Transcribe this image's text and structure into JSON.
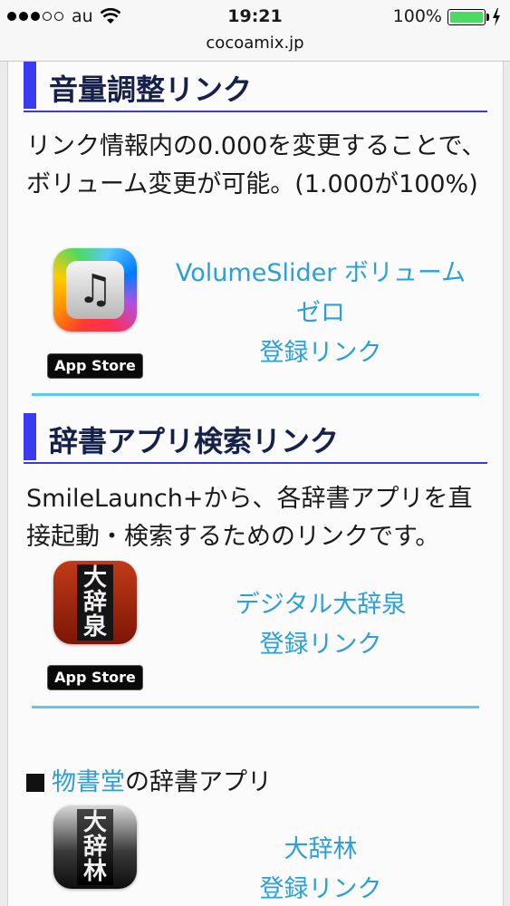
{
  "status_bar": {
    "carrier": "au",
    "time": "19:21",
    "battery_percent": "100%",
    "signal_bars_filled": 3,
    "signal_bars_total": 5
  },
  "browser": {
    "url": "cocoamix.jp"
  },
  "sections": [
    {
      "heading": "音量調整リンク",
      "description": "リンク情報内の0.000を変更することで、ボリューム変更が可能。(1.000が100%)",
      "app": {
        "icon": "music-note-icon",
        "store_badge": "App Store",
        "name": "VolumeSlider ボリュームゼロ",
        "link_label": "登録リンク"
      }
    },
    {
      "heading": "辞書アプリ検索リンク",
      "description": "SmileLaunch+から、各辞書アプリを直接起動・検索するためのリンクです。",
      "app": {
        "icon": "daijisen-icon",
        "icon_chars": [
          "大",
          "辞",
          "泉"
        ],
        "store_badge": "App Store",
        "name": "デジタル大辞泉",
        "link_label": "登録リンク"
      }
    }
  ],
  "publisher_line": {
    "marker": "■",
    "publisher_link": "物書堂",
    "suffix": "の辞書アプリ"
  },
  "publisher_app": {
    "icon": "daijirin-icon",
    "icon_chars": [
      "大",
      "辞",
      "林"
    ],
    "name": "大辞林",
    "link_label": "登録リンク"
  },
  "colors": {
    "link": "#2b9fd6",
    "heading_accent": "#3a3af0",
    "divider": "#5fc6ee",
    "battery": "#4cd964"
  }
}
